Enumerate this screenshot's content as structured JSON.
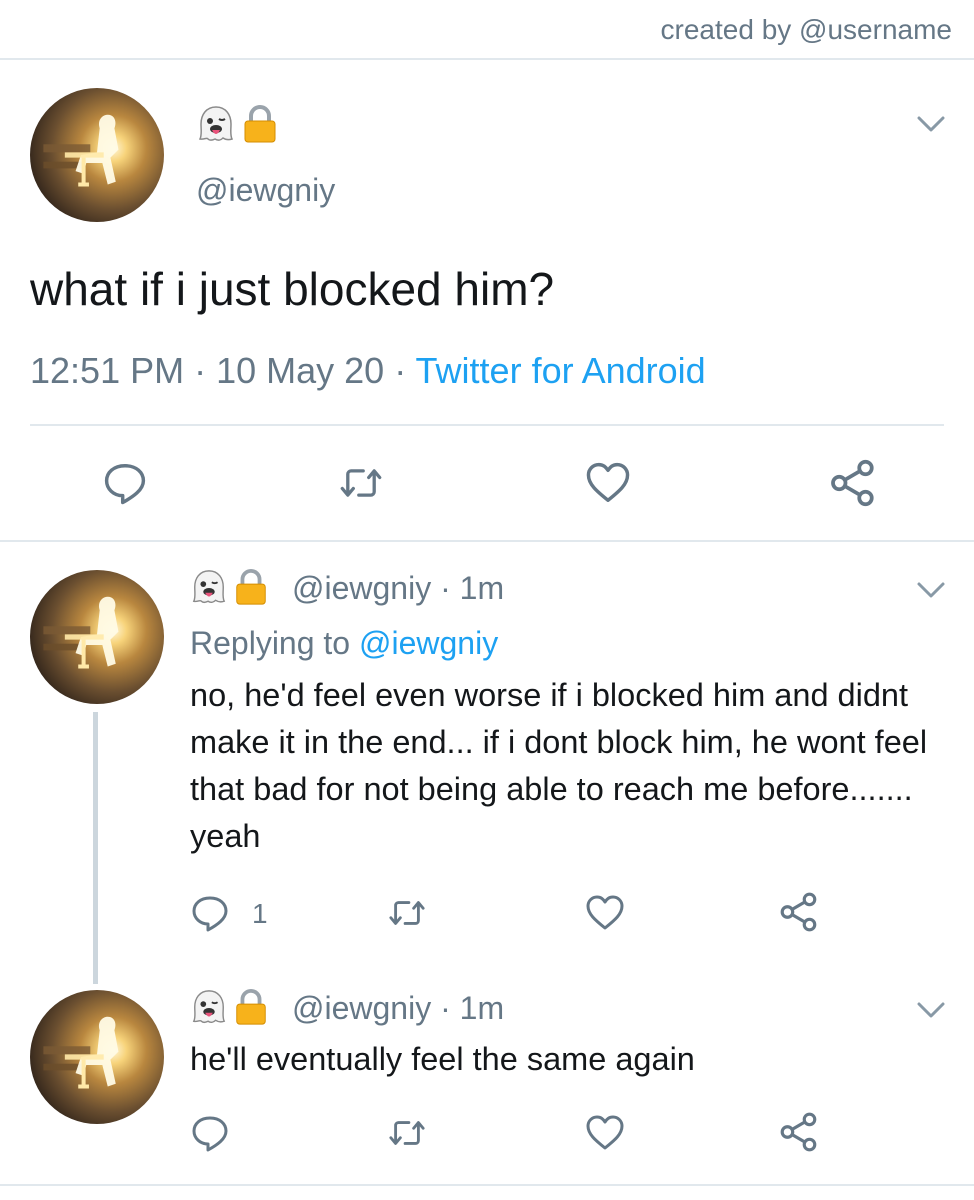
{
  "credit": "created by @username",
  "main_tweet": {
    "display_emojis": [
      "ghost-emoji",
      "lock-emoji"
    ],
    "handle": "@iewgniy",
    "text": "what if i just blocked him?",
    "time": "12:51 PM",
    "separator": " · ",
    "date": "10 May 20",
    "source": "Twitter for Android"
  },
  "replies": [
    {
      "header": "@iewgniy · 1m",
      "replying_prefix": "Replying to ",
      "replying_to": "@iewgniy",
      "text": "no, he'd feel even worse if i blocked him and didnt make it in the end... if i dont block him, he wont feel that bad for not being able to reach me before....... yeah",
      "reply_count": "1"
    },
    {
      "header": "@iewgniy · 1m",
      "text": "he'll eventually feel the same again"
    }
  ],
  "icons": [
    "reply-icon",
    "retweet-icon",
    "like-icon",
    "share-icon",
    "chevron-down-icon",
    "ghost-emoji",
    "lock-emoji"
  ],
  "colors": {
    "text": "#14171a",
    "muted": "#657786",
    "link": "#1da1f2",
    "divider": "#e1e8ed",
    "thread": "#ccd6dd"
  }
}
